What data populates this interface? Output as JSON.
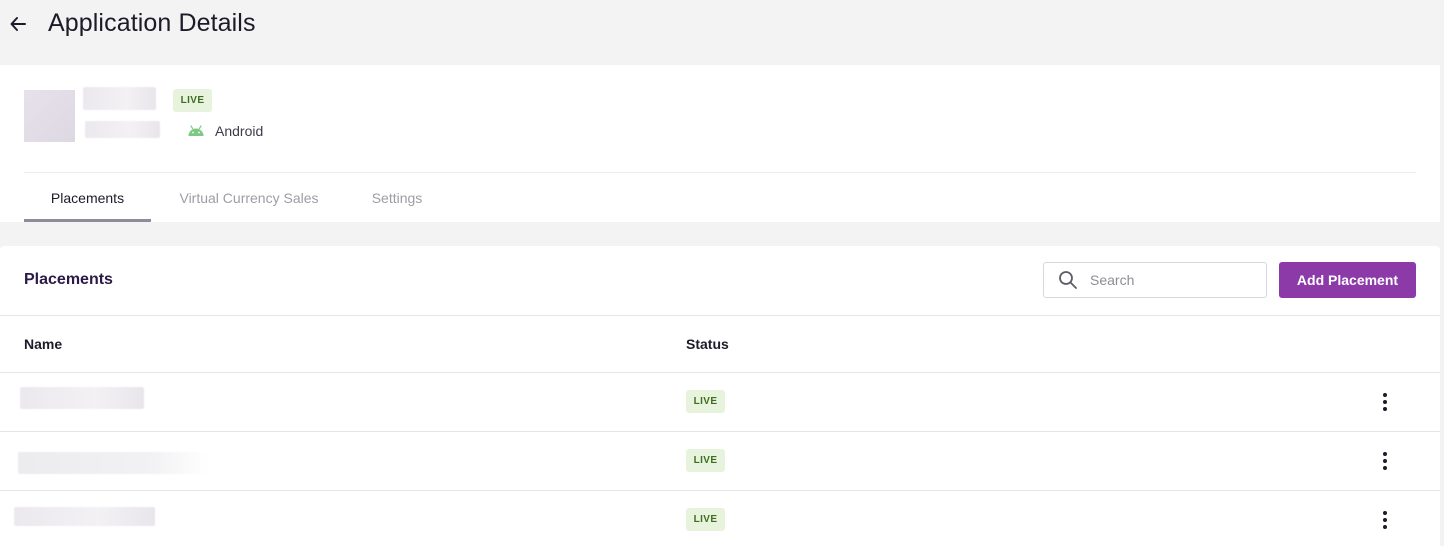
{
  "header": {
    "title": "Application Details",
    "back_icon": "arrow-left-icon"
  },
  "app": {
    "status": "LIVE",
    "platform": "Android",
    "platform_icon": "android-icon"
  },
  "tabs": [
    {
      "label": "Placements",
      "active": true
    },
    {
      "label": "Virtual Currency Sales",
      "active": false
    },
    {
      "label": "Settings",
      "active": false
    }
  ],
  "placements": {
    "title": "Placements",
    "search_placeholder": "Search",
    "add_button": "Add Placement",
    "columns": {
      "name": "Name",
      "status": "Status"
    },
    "rows": [
      {
        "status": "LIVE"
      },
      {
        "status": "LIVE"
      },
      {
        "status": "LIVE"
      }
    ]
  },
  "colors": {
    "accent": "#8d3aa9",
    "live_badge_bg": "#e7f3dd",
    "live_badge_text": "#3f6d1f",
    "android_green": "#7cc982"
  }
}
